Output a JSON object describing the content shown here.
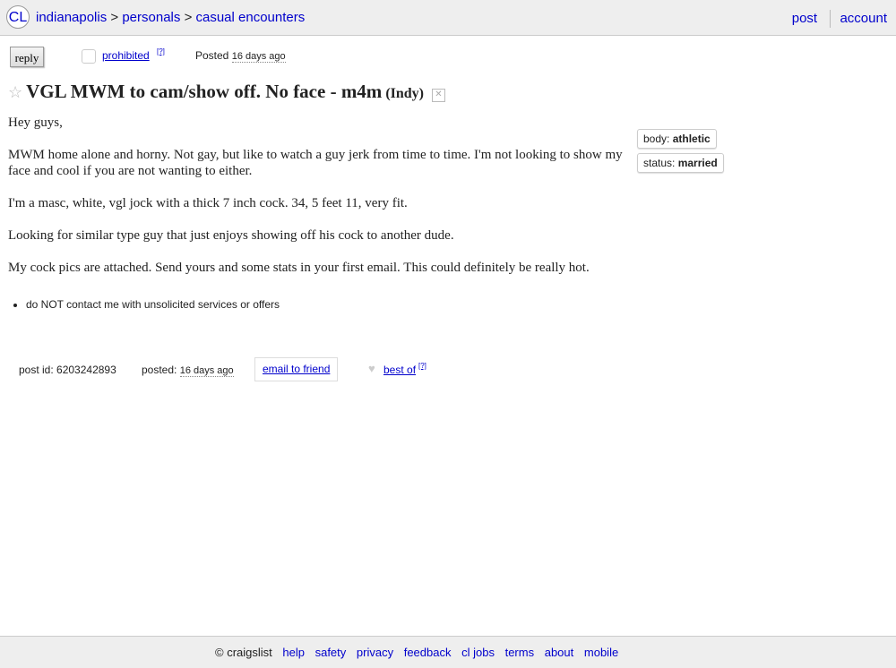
{
  "header": {
    "logo": "CL",
    "breadcrumbs": [
      "indianapolis",
      "personals",
      "casual encounters"
    ],
    "separator": ">",
    "post_link": "post",
    "account_link": "account"
  },
  "actions": {
    "reply_label": "reply",
    "prohibited_label": "prohibited",
    "help_marker": "[?]",
    "posted_label": "Posted",
    "posted_date": "16 days ago"
  },
  "posting": {
    "title": "VGL MWM to cam/show off. No face - m4m",
    "location": "(Indy)",
    "body": [
      "Hey guys,",
      "MWM home alone and horny. Not gay, but like to watch a guy jerk from time to time. I'm not looking to show my face and cool if you are not wanting to either.",
      "I'm a masc, white, vgl jock with a thick 7 inch cock. 34, 5 feet 11, very fit.",
      "Looking for similar type guy that just enjoys showing off his cock to another dude.",
      "My cock pics are attached. Send yours and some stats in your first email. This could definitely be really hot."
    ],
    "attributes": [
      {
        "label": "body:",
        "value": "athletic"
      },
      {
        "label": "status:",
        "value": "married"
      }
    ],
    "notice": "do NOT contact me with unsolicited services or offers"
  },
  "postinfo": {
    "post_id": "post id: 6203242893",
    "posted_label": "posted:",
    "posted_date": "16 days ago",
    "email_friend": "email to friend",
    "best_of": "best of",
    "help_marker": "[?]"
  },
  "footer": {
    "copyright": "© craigslist",
    "links": [
      "help",
      "safety",
      "privacy",
      "feedback",
      "cl jobs",
      "terms",
      "about",
      "mobile"
    ]
  }
}
